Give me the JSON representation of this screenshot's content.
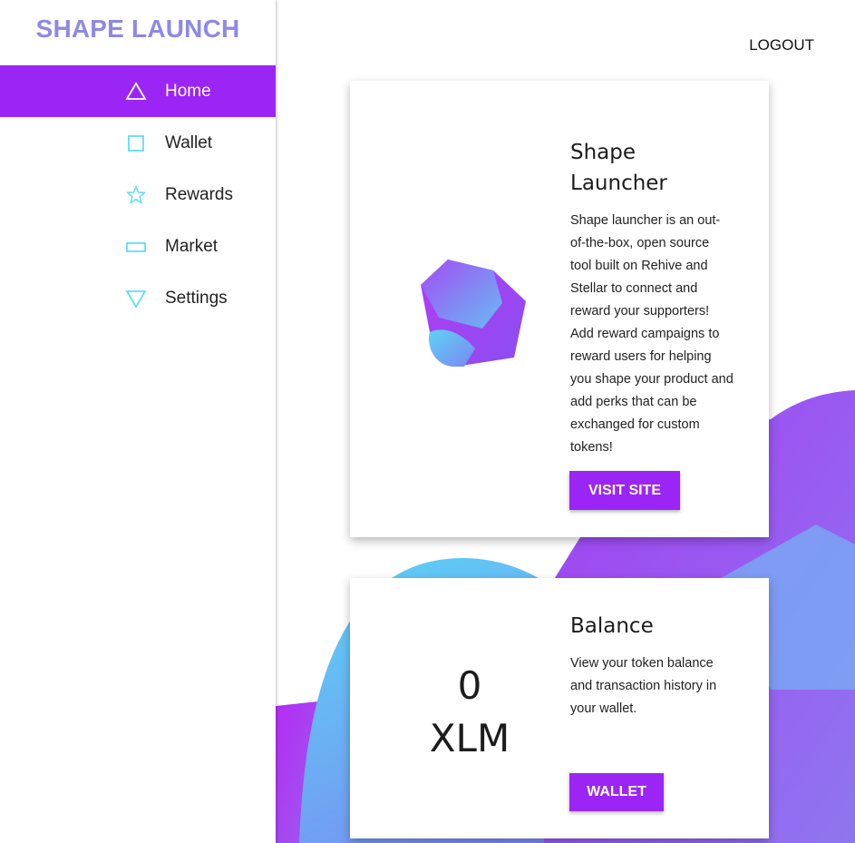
{
  "brand": {
    "title": "SHAPE LAUNCH"
  },
  "header": {
    "logout_label": "LOGOUT"
  },
  "sidebar": {
    "items": [
      {
        "label": "Home",
        "icon": "triangle-icon",
        "active": true
      },
      {
        "label": "Wallet",
        "icon": "square-icon",
        "active": false
      },
      {
        "label": "Rewards",
        "icon": "star-icon",
        "active": false
      },
      {
        "label": "Market",
        "icon": "rectangle-icon",
        "active": false
      },
      {
        "label": "Settings",
        "icon": "inverted-triangle-icon",
        "active": false
      }
    ]
  },
  "cards": {
    "launcher": {
      "title": "Shape Launcher",
      "body": "Shape launcher is an out-of-the-box, open source tool built on Rehive and Stellar to connect and reward your supporters! Add reward campaigns to reward users for helping you shape your product and add perks that can be exchanged for custom tokens!",
      "button_label": "VISIT SITE"
    },
    "balance": {
      "title": "Balance",
      "amount": "0",
      "currency": "XLM",
      "body": "View your token balance and transaction history in your wallet.",
      "button_label": "WALLET"
    }
  },
  "colors": {
    "accent": "#9b25f5",
    "brand": "#8e89e6",
    "icon": "#5ee0f0"
  }
}
